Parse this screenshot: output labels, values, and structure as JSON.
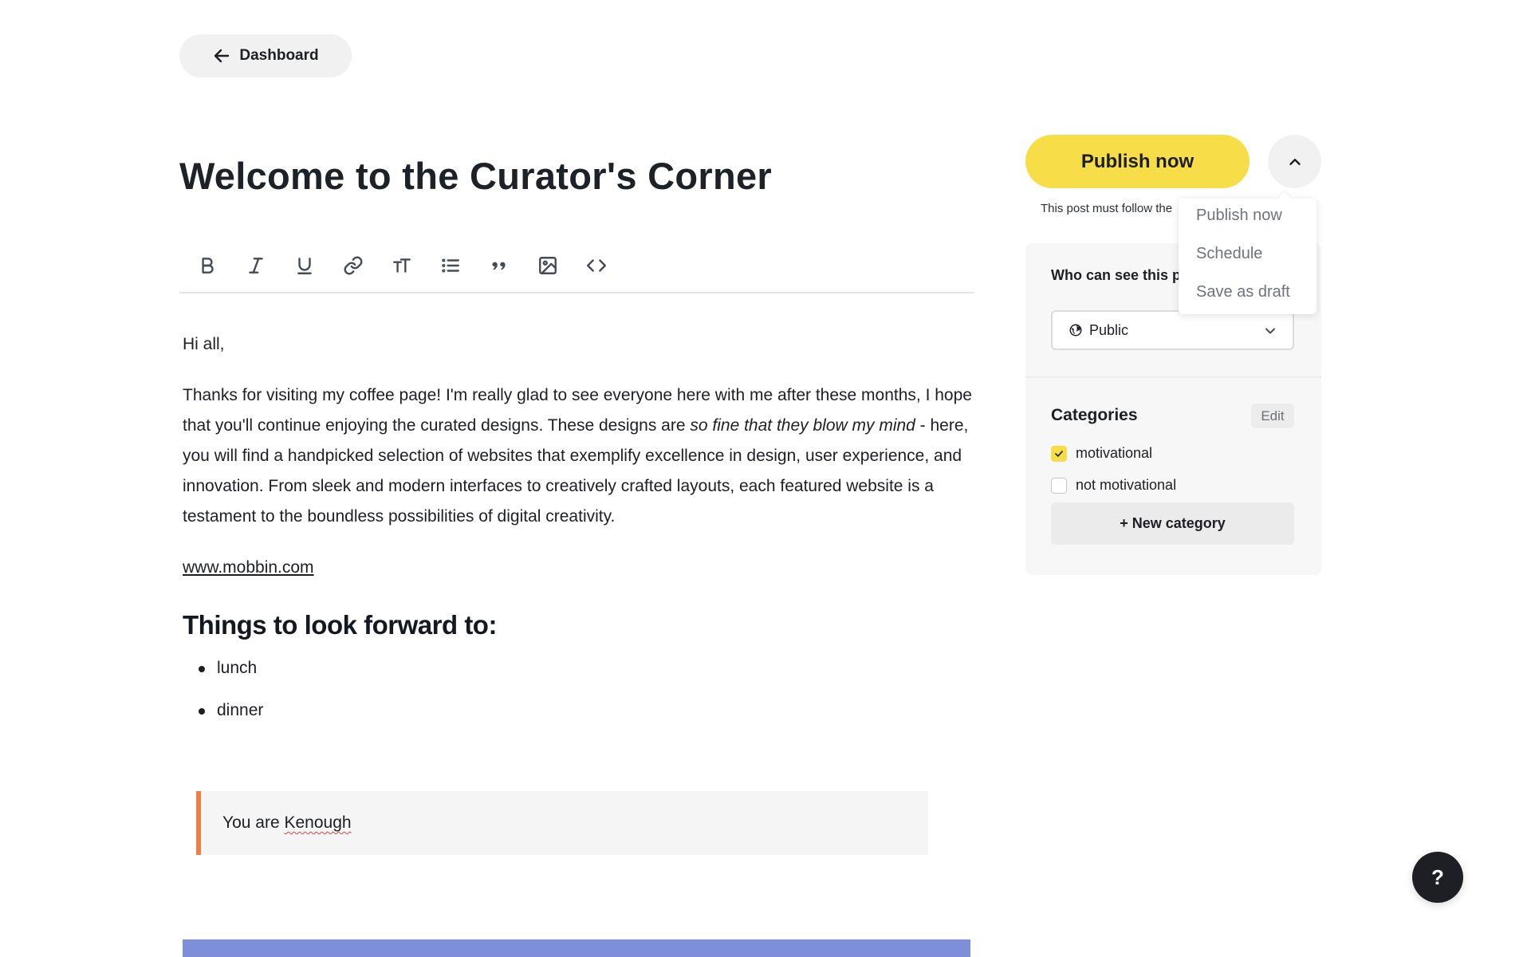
{
  "nav": {
    "back_label": "Dashboard"
  },
  "post": {
    "title": "Welcome to the Curator's Corner",
    "greeting": "Hi all,",
    "para1_start": "Thanks for visiting my coffee page! I'm really glad to see everyone here with me after these months, I hope that you'll continue enjoying the curated designs. These designs are ",
    "para1_italic": "so fine that they blow my mind",
    "para1_end": " - here, you will find a handpicked selection of websites that exemplify excellence in design, user experience, and innovation. From sleek and modern interfaces to creatively crafted layouts, each featured website is a testament to the boundless possibilities of digital creativity.",
    "link": "www.mobbin.com",
    "heading": "Things to look forward to:",
    "list": [
      "lunch",
      "dinner"
    ],
    "quote_prefix": "You are ",
    "quote_word": "Kenough"
  },
  "toolbar": {
    "tools": [
      "bold-icon",
      "italic-icon",
      "underline-icon",
      "link-icon",
      "text-size-icon",
      "bullet-list-icon",
      "quote-icon",
      "image-icon",
      "code-icon"
    ]
  },
  "publish": {
    "button_label": "Publish now",
    "rules_note": "This post must follow the",
    "menu": [
      "Publish now",
      "Schedule",
      "Save as draft"
    ]
  },
  "visibility": {
    "label": "Who can see this post?",
    "selected": "Public"
  },
  "categories": {
    "title": "Categories",
    "edit_label": "Edit",
    "items": [
      {
        "label": "motivational",
        "checked": true
      },
      {
        "label": "not motivational",
        "checked": false
      }
    ],
    "new_label": "+ New category"
  },
  "help": {
    "label": "?"
  },
  "colors": {
    "accent": "#f7de48",
    "quote_border": "#ee7d47",
    "cover": "#7f8ed9",
    "dark": "#1d1f24"
  }
}
